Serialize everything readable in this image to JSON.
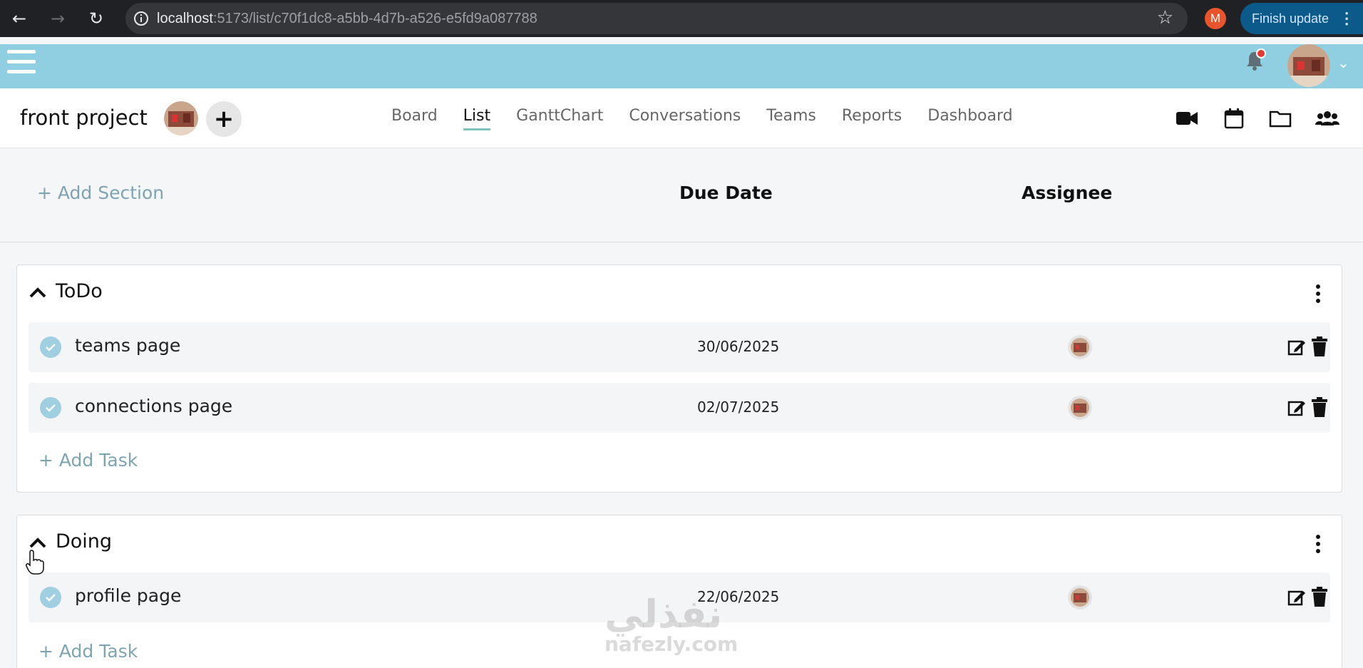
{
  "browser": {
    "url_host": "localhost",
    "url_path": ":5173/list/c70f1dc8-a5bb-4d7b-a526-e5fd9a087788",
    "profile_initial": "M",
    "finish_update_label": "Finish update"
  },
  "project": {
    "title": "front project",
    "add_member_label": "+"
  },
  "tabs": [
    {
      "label": "Board"
    },
    {
      "label": "List",
      "active": true
    },
    {
      "label": "GanttChart"
    },
    {
      "label": "Conversations"
    },
    {
      "label": "Teams"
    },
    {
      "label": "Reports"
    },
    {
      "label": "Dashboard"
    }
  ],
  "header_icons": [
    "video-icon",
    "calendar-icon",
    "folder-icon",
    "team-icon"
  ],
  "columns": {
    "add_section": "+ Add Section",
    "due_date": "Due Date",
    "assignee": "Assignee"
  },
  "sections": [
    {
      "title": "ToDo",
      "tasks": [
        {
          "name": "teams page",
          "due": "30/06/2025"
        },
        {
          "name": "connections page",
          "due": "02/07/2025"
        }
      ],
      "add_task": "+ Add Task"
    },
    {
      "title": "Doing",
      "tasks": [
        {
          "name": "profile page",
          "due": "22/06/2025"
        }
      ],
      "add_task": "+ Add Task"
    }
  ],
  "watermark": {
    "arabic": "نفذلي",
    "latin": "nafezly.com"
  },
  "colors": {
    "app_bar": "#90cfe2",
    "accent": "#7fc2b9",
    "link": "#7fa4b1",
    "check": "#9fcfe0"
  }
}
